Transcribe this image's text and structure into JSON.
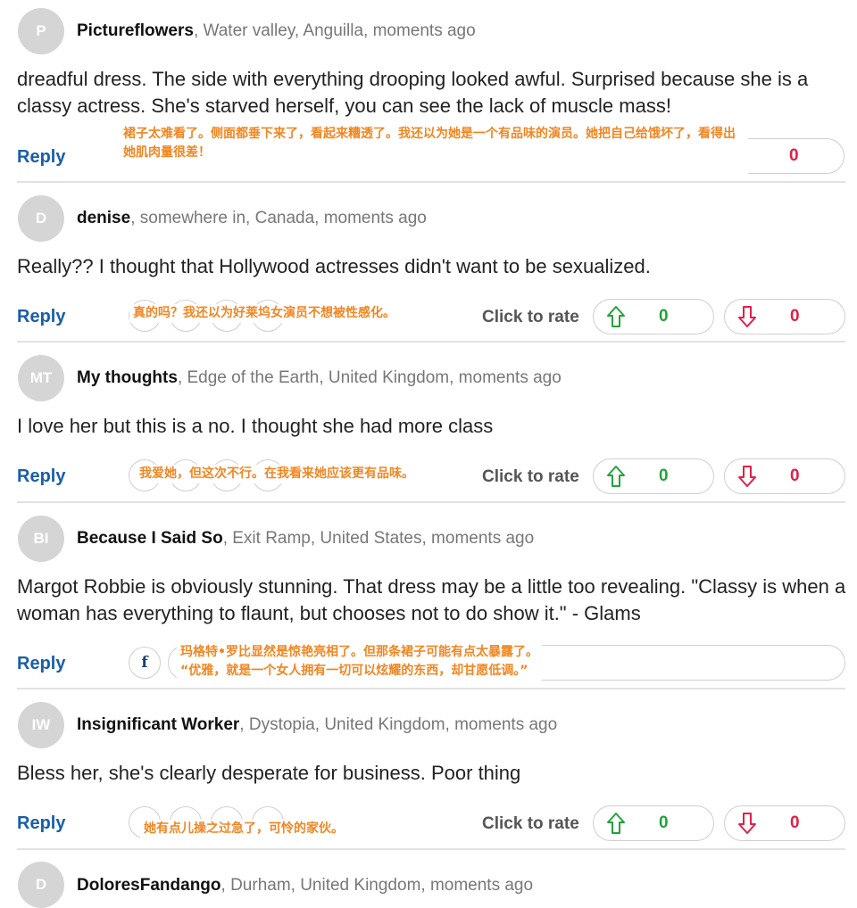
{
  "common": {
    "reply_label": "Reply",
    "click_to_rate": "Click to rate"
  },
  "comments": [
    {
      "initials": "P",
      "author": "Pictureflowers",
      "meta": ", Water valley, Anguilla, moments ago",
      "text": "dreadful dress. The side with everything drooping looked awful. Surprised because she is a classy actress. She's starved herself, you can see the lack of muscle mass!",
      "annotation": "裙子太难看了。侧面都垂下来了，看起来糟透了。我还以为她是一个有品味的演员。她把自己给饿坏了，看得出她肌肉量很差！",
      "down_count": "0"
    },
    {
      "initials": "D",
      "author": "denise",
      "meta": ", somewhere in, Canada, moments ago",
      "text": "Really?? I thought that Hollywood actresses didn't want to be sexualized.",
      "annotation": "真的吗？我还以为好莱坞女演员不想被性感化。",
      "up_count": "0",
      "down_count": "0"
    },
    {
      "initials": "MT",
      "author": "My thoughts",
      "meta": ", Edge of the Earth, United Kingdom, moments ago",
      "text": "I love her but this is a no. I thought she had more class",
      "annotation": "我爱她，但这次不行。在我看来她应该更有品味。",
      "up_count": "0",
      "down_count": "0"
    },
    {
      "initials": "BI",
      "author": "Because I Said So",
      "meta": ", Exit Ramp, United States, moments ago",
      "text": "Margot Robbie is obviously stunning. That dress may be a little too revealing. \"Classy is when a woman has everything to flaunt, but chooses not to do show it.\" - Glams",
      "annotation_line1": "玛格特•罗比显然是惊艳亮相了。但那条裙子可能有点太暴露了。",
      "annotation_line2": "“优雅，就是一个女人拥有一切可以炫耀的东西，却甘愿低调。”",
      "share_icon_label": "f"
    },
    {
      "initials": "IW",
      "author": "Insignificant Worker",
      "meta": ", Dystopia, United Kingdom, moments ago",
      "text": "Bless her, she's clearly desperate for business. Poor thing",
      "annotation": "她有点儿操之过急了，可怜的家伙。",
      "up_count": "0",
      "down_count": "0"
    },
    {
      "initials": "D",
      "author": "DoloresFandango",
      "meta": ", Durham, United Kingdom, moments ago"
    }
  ],
  "colors": {
    "link": "#1a5ea8",
    "up": "#22a33b",
    "down": "#e0204a",
    "annotation": "#f08622",
    "avatar": "#d5d5d5"
  }
}
